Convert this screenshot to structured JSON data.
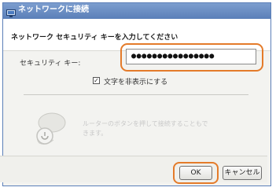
{
  "window": {
    "title": "ネットワークに接続"
  },
  "dialog": {
    "heading": "ネットワーク セキュリティ キーを入力してください",
    "security_key": {
      "label": "セキュリティ キー:",
      "value": "●●●●●●●●●●●●●●●●"
    },
    "hide_characters": {
      "checked": true,
      "label": "文字を非表示にする"
    },
    "router_hint": {
      "line1": "ルーターのボタンを押して接続することもで",
      "line2": "きます。"
    }
  },
  "footer": {
    "ok_label": "OK",
    "cancel_label": "キャンセル"
  },
  "colors": {
    "highlight": "#e47b2a",
    "titlebar": "#5a7fb8"
  },
  "icons": {
    "title": "network-icon",
    "router": "wps-router-icon"
  }
}
